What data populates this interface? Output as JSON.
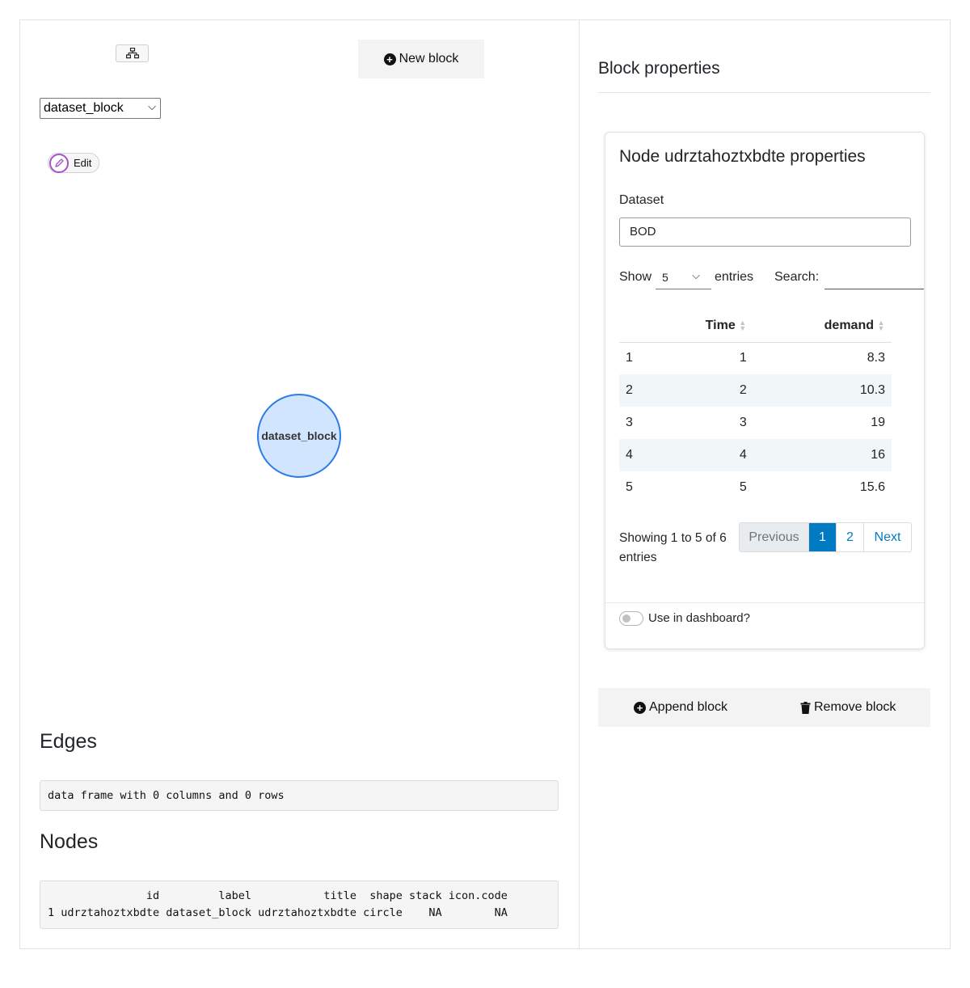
{
  "left": {
    "new_block_label": "New block",
    "block_select_value": "dataset_block",
    "edit_label": "Edit",
    "graph_node_label": "dataset_block",
    "edges_heading": "Edges",
    "edges_output": "data frame with 0 columns and 0 rows",
    "nodes_heading": "Nodes",
    "nodes_output": "               id         label           title  shape stack icon.code\n1 udrztahoztxbdte dataset_block udrztahoztxbdte circle    NA        NA"
  },
  "right": {
    "title": "Block properties",
    "card": {
      "title": "Node udrztahoztxbdte properties",
      "dataset_label": "Dataset",
      "dataset_value": "BOD",
      "show_label": "Show",
      "length_value": "5",
      "entries_label": "entries",
      "search_label": "Search:",
      "columns": [
        "",
        "Time",
        "demand"
      ],
      "rows": [
        [
          "1",
          "1",
          "8.3"
        ],
        [
          "2",
          "2",
          "10.3"
        ],
        [
          "3",
          "3",
          "19"
        ],
        [
          "4",
          "4",
          "16"
        ],
        [
          "5",
          "5",
          "15.6"
        ]
      ],
      "info": "Showing 1 to 5 of 6 entries",
      "pager": {
        "prev": "Previous",
        "pages": [
          "1",
          "2"
        ],
        "next": "Next"
      },
      "toggle_label": "Use in dashboard?"
    },
    "append_label": "Append block",
    "remove_label": "Remove block"
  }
}
